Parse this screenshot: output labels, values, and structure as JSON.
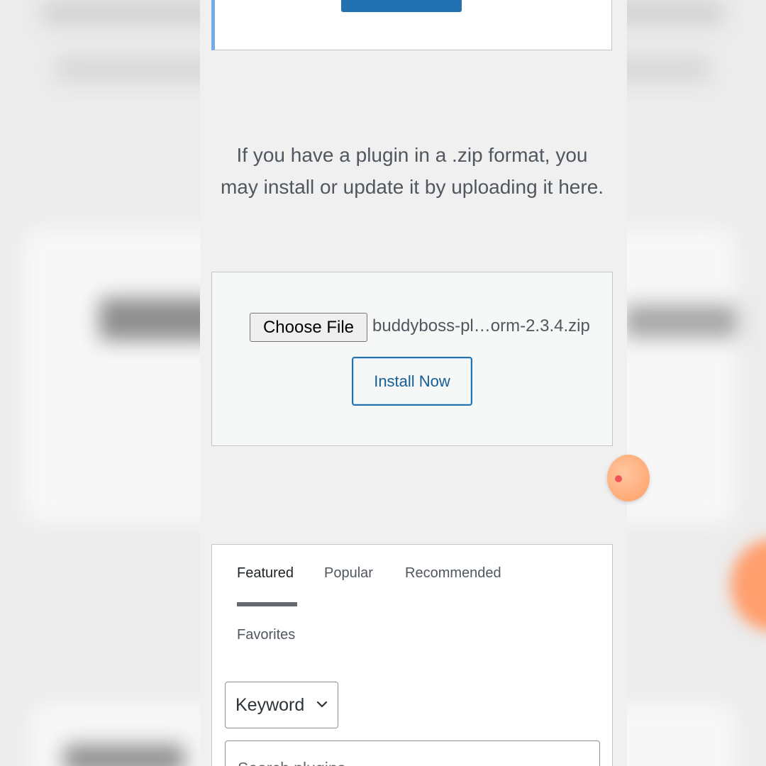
{
  "upload": {
    "help_text": "If you have a plugin in a .zip format, you may install or update it by uploading it here.",
    "choose_file_label": "Choose File",
    "file_name": "buddyboss-pl…orm-2.3.4.zip",
    "install_label": "Install Now"
  },
  "filter": {
    "tabs": [
      {
        "label": "Featured",
        "active": true
      },
      {
        "label": "Popular",
        "active": false
      },
      {
        "label": "Recommended",
        "active": false
      },
      {
        "label": "Favorites",
        "active": false
      }
    ],
    "search_type": "Keyword",
    "search_placeholder": "Search plugins..."
  },
  "icons": {
    "select_arrow": "chevron-down-icon",
    "recorder": "record-indicator-icon"
  },
  "colors": {
    "primary": "#2271b1",
    "notice_border": "#72aee6",
    "text": "#50575e",
    "recorder": "#ff9f66"
  }
}
